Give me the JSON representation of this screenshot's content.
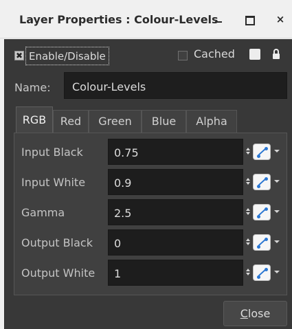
{
  "window": {
    "title": "Layer Properties : Colour-Levels",
    "controls": {
      "minimize_icon": "minimize-icon",
      "maximize_icon": "maximize-icon",
      "close_glyph": "×"
    }
  },
  "top": {
    "enable_checked": true,
    "enable_check_glyph": "✖",
    "enable_label": "Enable/Disable",
    "cached_checked": false,
    "cached_label": "Cached",
    "color_swatch": "#ededed",
    "lock_icon": "lock-icon"
  },
  "name": {
    "label": "Name:",
    "value": "Colour-Levels"
  },
  "tabs": [
    {
      "label": "RGB",
      "active": true
    },
    {
      "label": "Red",
      "active": false
    },
    {
      "label": "Green",
      "active": false
    },
    {
      "label": "Blue",
      "active": false
    },
    {
      "label": "Alpha",
      "active": false
    }
  ],
  "parameters": [
    {
      "label": "Input Black",
      "value": "0.75"
    },
    {
      "label": "Input White",
      "value": "0.9"
    },
    {
      "label": "Gamma",
      "value": "2.5"
    },
    {
      "label": "Output Black",
      "value": "0"
    },
    {
      "label": "Output White",
      "value": "1"
    }
  ],
  "footer": {
    "close_label_rest": "lose",
    "close_label_mnemonic": "C"
  },
  "colors": {
    "panel_bg": "#383838",
    "field_bg": "#1e1e1e",
    "curve_accent": "#2a76d2",
    "titlebar_bg": "#f0f0f0"
  }
}
